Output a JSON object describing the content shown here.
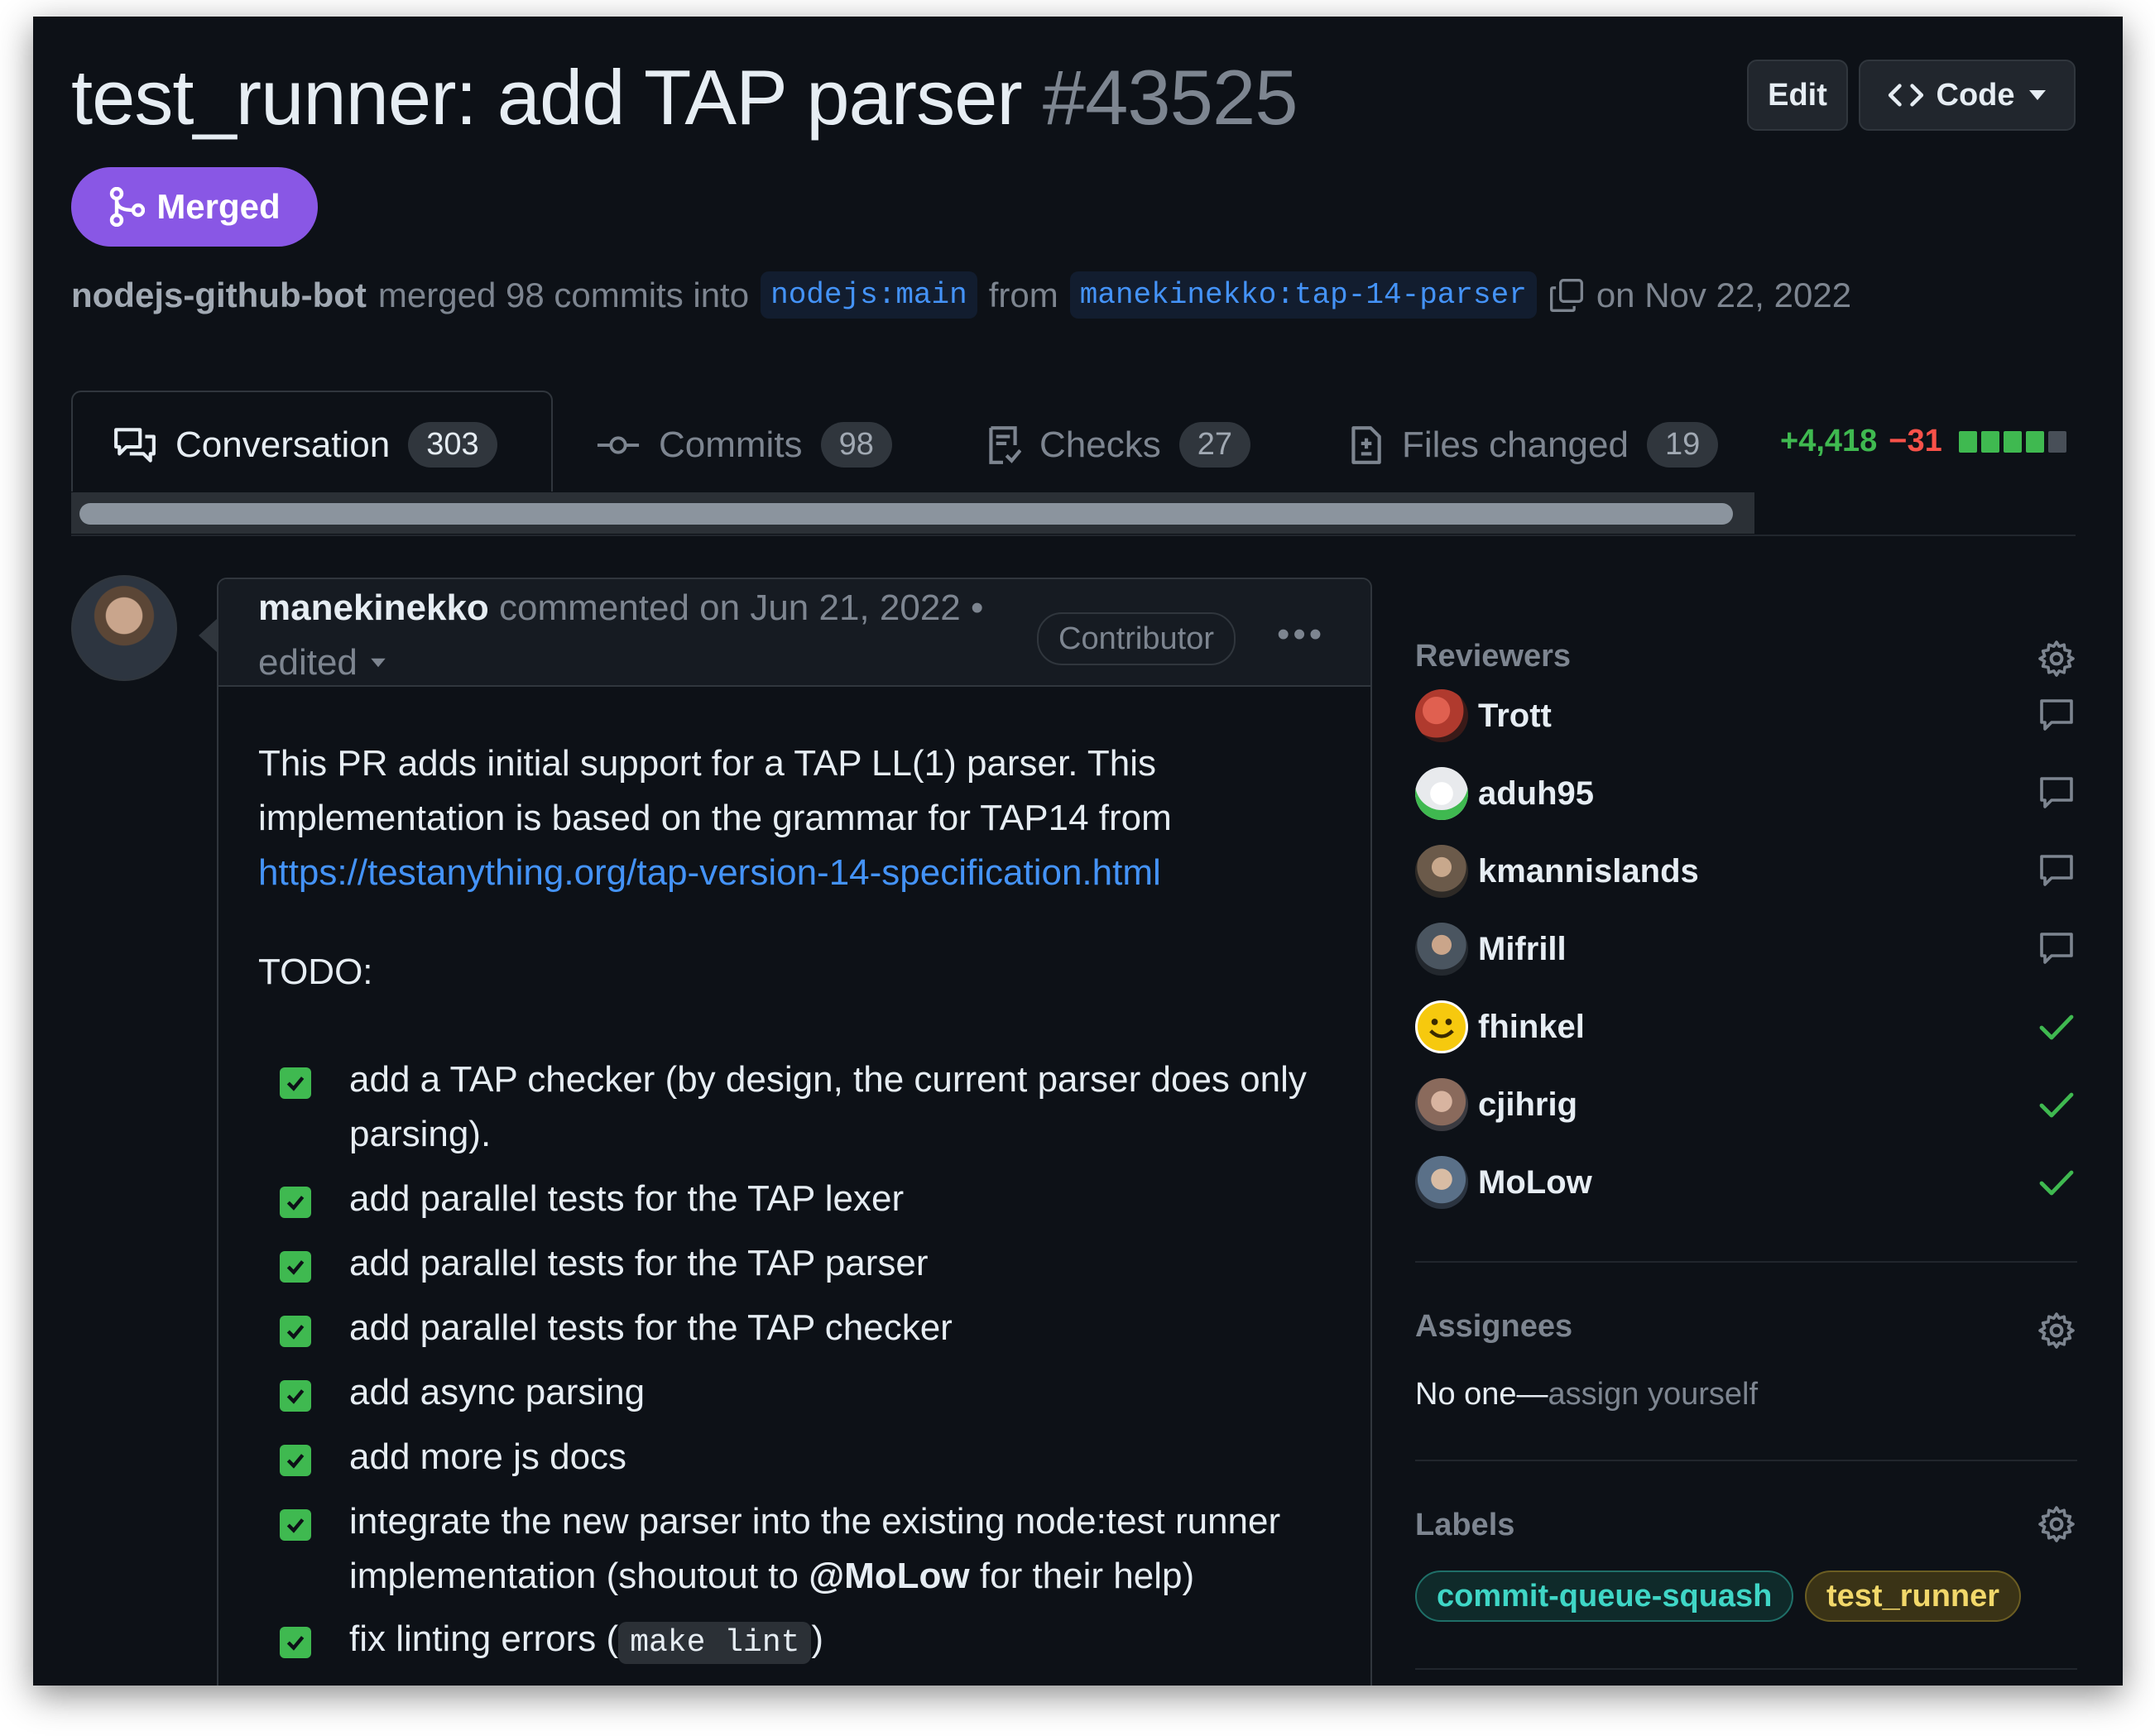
{
  "pr": {
    "title": "test_runner: add TAP parser",
    "number": "#43525",
    "state": "Merged",
    "merged_by": "nodejs-github-bot",
    "merge_text": "merged 98 commits into",
    "base_branch": "nodejs:main",
    "from_text": "from",
    "head_branch": "manekinekko:tap-14-parser",
    "merged_date": "on Nov 22, 2022"
  },
  "header_buttons": {
    "edit": "Edit",
    "code": "Code"
  },
  "tabs": [
    {
      "label": "Conversation",
      "count": "303",
      "icon": "comment-discussion-icon",
      "active": true
    },
    {
      "label": "Commits",
      "count": "98",
      "icon": "git-commit-icon",
      "active": false
    },
    {
      "label": "Checks",
      "count": "27",
      "icon": "checklist-icon",
      "active": false
    },
    {
      "label": "Files changed",
      "count": "19",
      "icon": "file-diff-icon",
      "active": false
    }
  ],
  "diffstat": {
    "additions": "+4,418",
    "deletions": "−31",
    "blocks": [
      "#3fb950",
      "#3fb950",
      "#3fb950",
      "#3fb950",
      "#484f58"
    ]
  },
  "comment": {
    "author": "manekinekko",
    "action": "commented on Jun 21, 2022 •",
    "edited": "edited",
    "role": "Contributor",
    "paragraph": "This PR adds initial support for a TAP LL(1) parser. This implementation is based on the grammar for TAP14 from",
    "link": "https://testanything.org/tap-version-14-specification.html",
    "todo_heading": "TODO:",
    "tasks": [
      {
        "text": "add a TAP checker (by design, the current parser does only parsing).",
        "checked": true
      },
      {
        "text": "add parallel tests for the TAP lexer",
        "checked": true
      },
      {
        "text": "add parallel tests for the TAP parser",
        "checked": true
      },
      {
        "text": "add parallel tests for the TAP checker",
        "checked": true
      },
      {
        "text": "add async parsing",
        "checked": true
      },
      {
        "text": "add more js docs",
        "checked": true
      },
      {
        "text_before": "integrate the new parser into the existing node:test runner implementation (shoutout to",
        "mention": "@MoLow",
        "text_after": "for their help)",
        "checked": true
      },
      {
        "text_before": "fix linting errors (",
        "code": "make lint",
        "text_after": ")",
        "checked": true
      }
    ]
  },
  "sidebar": {
    "reviewers_heading": "Reviewers",
    "reviewers": [
      {
        "name": "Trott",
        "status_icon": "comment-icon",
        "avatar_color": "#b03a2e"
      },
      {
        "name": "aduh95",
        "status_icon": "comment-icon",
        "avatar_color": "#e8eaed"
      },
      {
        "name": "kmannislands",
        "status_icon": "comment-icon",
        "avatar_color": "#6b5a4a"
      },
      {
        "name": "Mifrill",
        "status_icon": "comment-icon",
        "avatar_color": "#4a5560"
      },
      {
        "name": "fhinkel",
        "status_icon": "check-icon",
        "avatar_color": "#f6c90e"
      },
      {
        "name": "cjihrig",
        "status_icon": "check-icon",
        "avatar_color": "#8a6a5c"
      },
      {
        "name": "MoLow",
        "status_icon": "check-icon",
        "avatar_color": "#5a7088"
      }
    ],
    "assignees_heading": "Assignees",
    "assignees_none": "No one—",
    "assignees_self": "assign yourself",
    "labels_heading": "Labels",
    "labels": [
      {
        "name": "commit-queue-squash",
        "color": "#1f6f68"
      },
      {
        "name": "test_runner",
        "color": "#e6c84b"
      }
    ]
  },
  "colors": {
    "background": "#0d1117",
    "merged": "#8957e5",
    "link": "#4493f8",
    "success": "#3fb950",
    "danger": "#f85149"
  }
}
